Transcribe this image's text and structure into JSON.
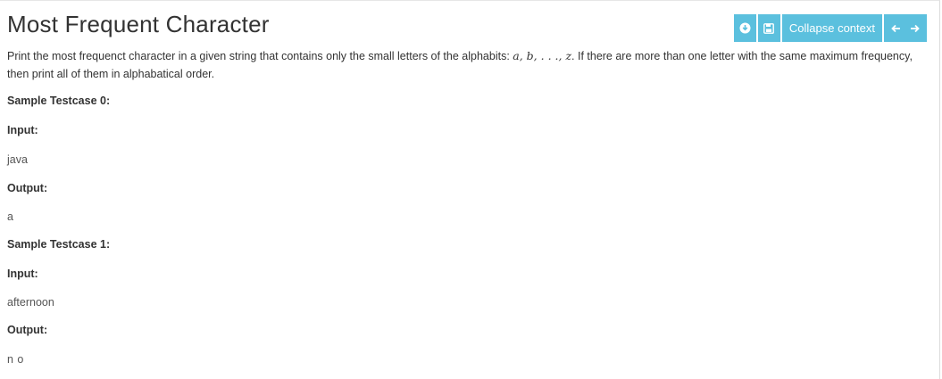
{
  "title": "Most Frequent Character",
  "toolbar": {
    "download_icon": "download-circle-icon",
    "save_icon": "floppy-disk-icon",
    "collapse_label": "Collapse context",
    "prev_icon": "arrow-left-icon",
    "next_icon": "arrow-right-icon",
    "accent": "#5bc0de"
  },
  "description": {
    "part1": "Print the most frequenct character in a given string that contains only the small letters of the alphabits: ",
    "math": "a, b, . . ., z",
    "part2": ". If there are more than one letter with the same maximum frequency, then print all of them in alphabatical order."
  },
  "testcases": [
    {
      "heading": "Sample Testcase 0:",
      "input_label": "Input:",
      "input": "java",
      "output_label": "Output:",
      "output": "a"
    },
    {
      "heading": "Sample Testcase 1:",
      "input_label": "Input:",
      "input": "afternoon",
      "output_label": "Output:",
      "output": "n o"
    }
  ]
}
